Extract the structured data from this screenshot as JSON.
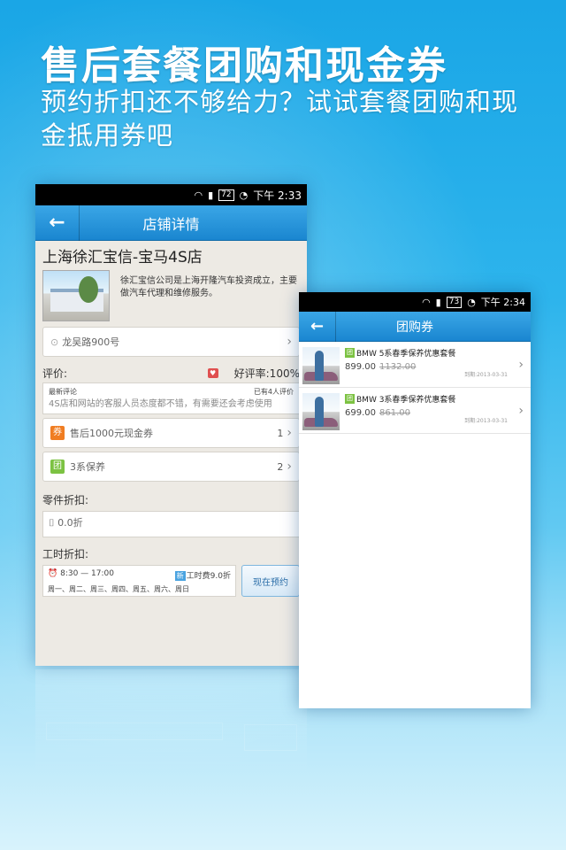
{
  "promo": {
    "title": "售后套餐团购和现金券",
    "subtitle": "预约折扣还不够给力？试试套餐团购和现金抵用券吧"
  },
  "colors": {
    "accent": "#1a86d0",
    "background": "#2db4ec",
    "coupon_badge": "#f07d22",
    "group_badge": "#7cc242"
  },
  "shop_screen": {
    "status_time": "下午 2:33",
    "battery": "72",
    "nav_title": "店铺详情",
    "shop_name": "上海徐汇宝信-宝马4S店",
    "shop_desc": "徐汇宝信公司是上海开隆汽车投资成立，主要做汽车代理和维修服务。",
    "address": "龙吴路900号",
    "rating_label": "评价:",
    "good_rate": "好评率:100%",
    "review": {
      "header": "最新评论",
      "count": "已有4人评价",
      "text": "4S店和网站的客服人员态度都不错，有需要还会考虑使用"
    },
    "coupon": {
      "badge": "券",
      "label": "售后1000元现金券",
      "count": "1"
    },
    "group": {
      "badge": "团",
      "label": "3系保养",
      "count": "2"
    },
    "parts_title": "零件折扣:",
    "parts_value": "0.0折",
    "labor_title": "工时折扣:",
    "labor": {
      "hours": "8:30 — 17:00",
      "badge": "新",
      "discount": "工时费9.0折",
      "days": "周一、周二、周三、周四、周五、周六、周日"
    },
    "book_button": "现在预约"
  },
  "groupbuy_screen": {
    "status_time": "下午 2:34",
    "battery": "73",
    "nav_title": "团购券",
    "items": [
      {
        "badge": "团",
        "title": "BMW 5系春季保养优惠套餐",
        "price": "899.00",
        "old_price": "1132.00",
        "expire": "到期:2013-03-31"
      },
      {
        "badge": "团",
        "title": "BMW 3系春季保养优惠套餐",
        "price": "699.00",
        "old_price": "861.00",
        "expire": "到期:2013-03-31"
      }
    ]
  }
}
